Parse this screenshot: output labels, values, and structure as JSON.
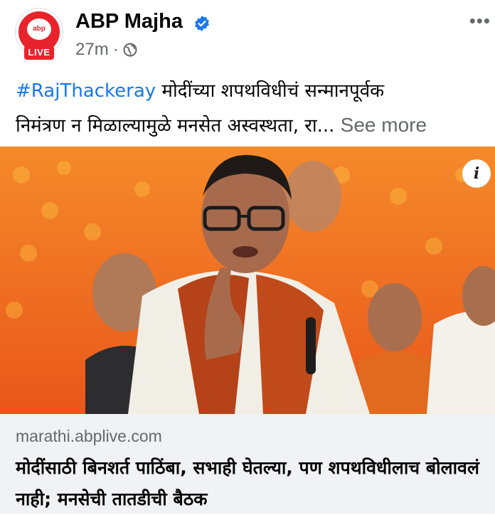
{
  "post": {
    "page_name": "ABP Majha",
    "avatar_badge": "LIVE",
    "avatar_logo": "abp",
    "time_ago": "27m",
    "separator": "·",
    "hashtag": "#RajThackeray",
    "caption_line1": " मोदींच्या शपथविधीचं सन्मानपूर्वक",
    "caption_line2": "निमंत्रण न मिळाल्यामुळे मनसेत अस्वस्थता, रा...",
    "see_more": "See more",
    "more_icon": "more-horizontal-icon",
    "info_icon_text": "i"
  },
  "link_preview": {
    "domain": "marathi.abplive.com",
    "title": "मोदींसाठी बिनशर्त पाठिंबा, सभाही घेतल्या, पण शपथविधीलाच बोलावलं नाही; मनसेची तातडीची बैठक"
  },
  "colors": {
    "brand_red": "#e8232c",
    "link_blue": "#1877f2",
    "muted_text": "#65676b",
    "preview_bg": "#f0f2f5",
    "photo_bg_orange": "#f26a1b"
  }
}
